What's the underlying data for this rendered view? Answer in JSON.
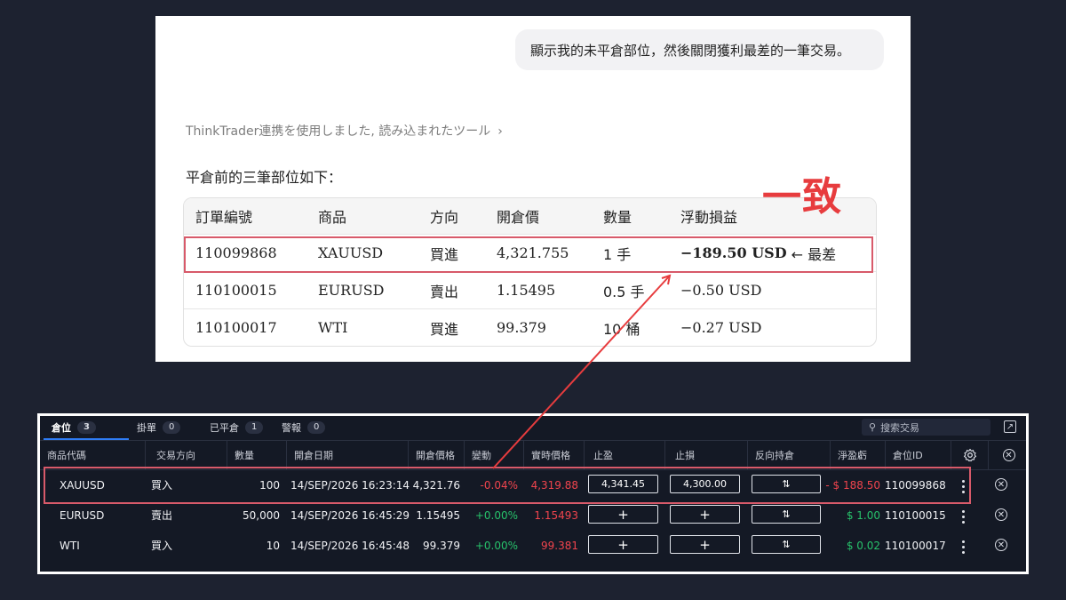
{
  "chat": {
    "user_message": "顯示我的未平倉部位，然後關閉獲利最差的一筆交易。",
    "tool_line": "ThinkTrader連携を使用しました, 読み込まれたツール",
    "tool_chevron": "›",
    "intro": "平倉前的三筆部位如下：",
    "table": {
      "headers": [
        "訂單編號",
        "商品",
        "方向",
        "開倉價",
        "數量",
        "浮動損益"
      ],
      "rows": [
        {
          "order": "110099868",
          "symbol": "XAUUSD",
          "direction": "買進",
          "price": "4,321.755",
          "qty": "1 手",
          "pnl": "−189.50 USD",
          "note": "← 最差"
        },
        {
          "order": "110100015",
          "symbol": "EURUSD",
          "direction": "賣出",
          "price": "1.15495",
          "qty": "0.5 手",
          "pnl": "−0.50 USD",
          "note": ""
        },
        {
          "order": "110100017",
          "symbol": "WTI",
          "direction": "買進",
          "price": "99.379",
          "qty": "10 桶",
          "pnl": "−0.27 USD",
          "note": ""
        }
      ]
    }
  },
  "annotation": {
    "label": "一致",
    "color": "#e73c3e"
  },
  "panel": {
    "tabs": [
      {
        "label": "倉位",
        "count": "3"
      },
      {
        "label": "掛單",
        "count": "0"
      },
      {
        "label": "已平倉",
        "count": "1"
      },
      {
        "label": "警報",
        "count": "0"
      }
    ],
    "search_placeholder": "搜索交易",
    "columns": [
      "商品代碼",
      "交易方向",
      "數量",
      "開倉日期",
      "開倉價格",
      "變動",
      "實時價格",
      "止盈",
      "止損",
      "反向持倉",
      "淨盈虧",
      "倉位ID"
    ],
    "rows": [
      {
        "symbol": "XAUUSD",
        "side": "買入",
        "qty": "100",
        "date": "14/SEP/2026 16:23:14",
        "open": "4,321.76",
        "change": "-0.04%",
        "live": "4,319.88",
        "tp": "4,341.45",
        "sl": "4,300.00",
        "reverse": "⇅",
        "pnl": "- $ 188.50",
        "id": "110099868"
      },
      {
        "symbol": "EURUSD",
        "side": "賣出",
        "qty": "50,000",
        "date": "14/SEP/2026 16:45:29",
        "open": "1.15495",
        "change": "+0.00%",
        "live": "1.15493",
        "tp": "+",
        "sl": "+",
        "reverse": "⇅",
        "pnl": "$ 1.00",
        "id": "110100015"
      },
      {
        "symbol": "WTI",
        "side": "買入",
        "qty": "10",
        "date": "14/SEP/2026 16:45:48",
        "open": "99.379",
        "change": "+0.00%",
        "live": "99.381",
        "tp": "+",
        "sl": "+",
        "reverse": "⇅",
        "pnl": "$ 0.02",
        "id": "110100017"
      }
    ],
    "colors": {
      "profit": "#27c26b",
      "loss": "#f0444d",
      "accent": "#2f7df6",
      "highlight": "#d85a6a"
    }
  }
}
